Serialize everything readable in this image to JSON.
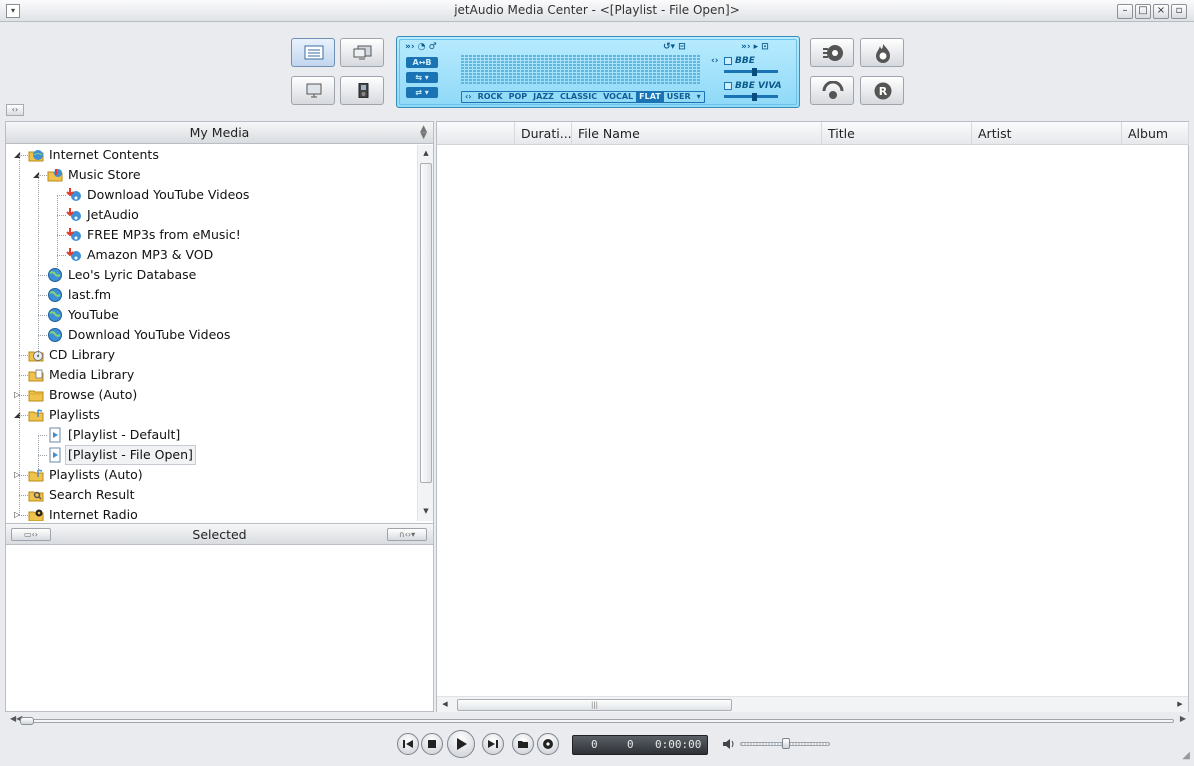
{
  "window": {
    "title": "jetAudio Media Center - <[Playlist - File Open]>"
  },
  "lcd": {
    "ab_label": "A↔B",
    "presets": [
      "ROCK",
      "POP",
      "JAZZ",
      "CLASSIC",
      "VOCAL",
      "FLAT",
      "USER"
    ],
    "active_preset": "FLAT",
    "bbe_label": "BBE",
    "bbe_viva_label": "BBE VIVA"
  },
  "left_panel": {
    "header": "My Media",
    "selected_header": "Selected",
    "tree": [
      {
        "label": "Internet Contents",
        "level": 0,
        "icon": "globe-folder-icon",
        "expanded": true
      },
      {
        "label": "Music Store",
        "level": 1,
        "icon": "music-store-icon",
        "expanded": true
      },
      {
        "label": "Download YouTube Videos",
        "level": 2,
        "icon": "music-download-icon"
      },
      {
        "label": "JetAudio",
        "level": 2,
        "icon": "music-download-icon"
      },
      {
        "label": "FREE MP3s from eMusic!",
        "level": 2,
        "icon": "music-download-icon"
      },
      {
        "label": "Amazon MP3 & VOD",
        "level": 2,
        "icon": "music-download-icon"
      },
      {
        "label": "Leo's Lyric Database",
        "level": 1,
        "icon": "globe-icon"
      },
      {
        "label": "last.fm",
        "level": 1,
        "icon": "globe-icon"
      },
      {
        "label": "YouTube",
        "level": 1,
        "icon": "globe-icon"
      },
      {
        "label": "Download YouTube Videos",
        "level": 1,
        "icon": "globe-icon"
      },
      {
        "label": "CD Library",
        "level": 0,
        "icon": "cd-folder-icon"
      },
      {
        "label": "Media Library",
        "level": 0,
        "icon": "library-folder-icon"
      },
      {
        "label": "Browse (Auto)",
        "level": 0,
        "icon": "folder-icon",
        "collapsed": true
      },
      {
        "label": "Playlists",
        "level": 0,
        "icon": "playlist-folder-icon",
        "expanded": true
      },
      {
        "label": "[Playlist - Default]",
        "level": 1,
        "icon": "playlist-icon"
      },
      {
        "label": "[Playlist - File Open]",
        "level": 1,
        "icon": "playlist-icon",
        "selected": true
      },
      {
        "label": "Playlists (Auto)",
        "level": 0,
        "icon": "playlist-folder-icon",
        "collapsed": true
      },
      {
        "label": "Search Result",
        "level": 0,
        "icon": "search-folder-icon"
      },
      {
        "label": "Internet Radio",
        "level": 0,
        "icon": "radio-folder-icon",
        "collapsed": true
      }
    ]
  },
  "right_panel": {
    "columns": [
      "",
      "Durati...",
      "File Name",
      "Title",
      "Artist",
      "Album"
    ]
  },
  "transport": {
    "track": "0",
    "count": "0",
    "time": "0:00:00"
  },
  "colors": {
    "lcd_bg": "#9fe1fb",
    "lcd_ink": "#1a73b3",
    "panel_header": "#d9dce0",
    "selection_border": "#c7cbd1"
  }
}
